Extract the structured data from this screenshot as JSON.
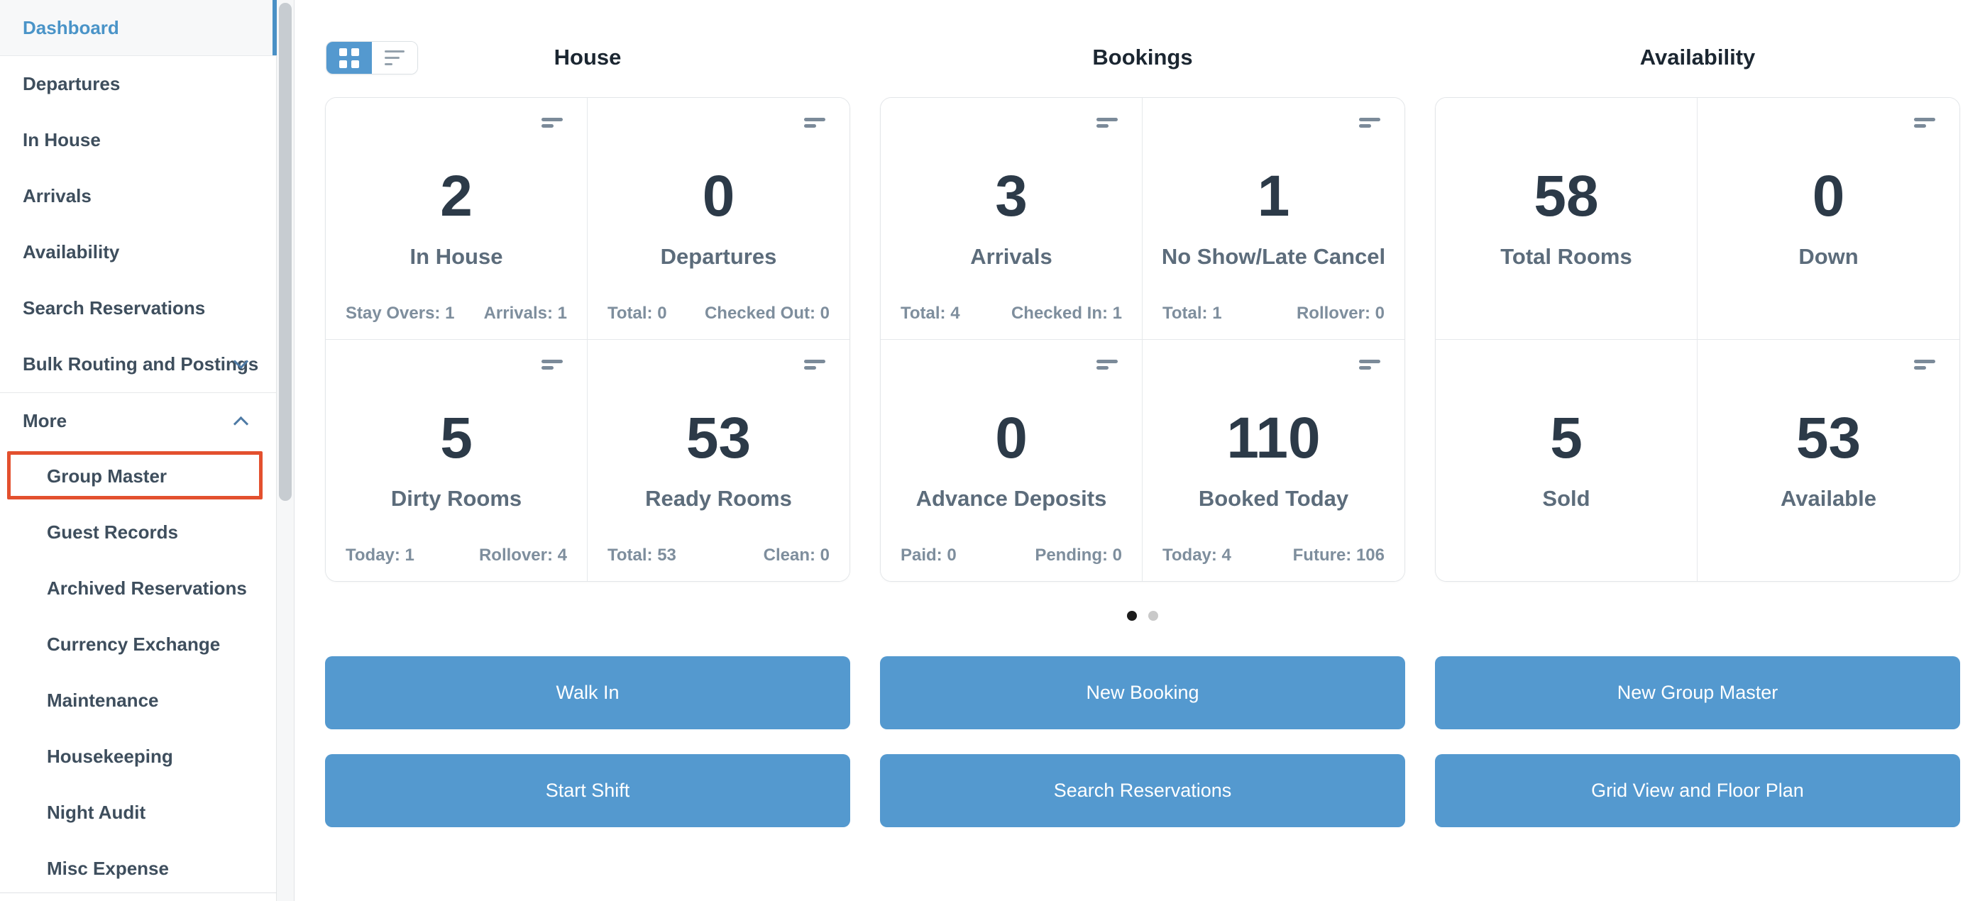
{
  "sidebar": {
    "items": [
      {
        "label": "Dashboard"
      },
      {
        "label": "Departures"
      },
      {
        "label": "In House"
      },
      {
        "label": "Arrivals"
      },
      {
        "label": "Availability"
      },
      {
        "label": "Search Reservations"
      },
      {
        "label": "Bulk Routing and Postings"
      },
      {
        "label": "More"
      },
      {
        "label": "Group Master"
      },
      {
        "label": "Guest Records"
      },
      {
        "label": "Archived Reservations"
      },
      {
        "label": "Currency Exchange"
      },
      {
        "label": "Maintenance"
      },
      {
        "label": "Housekeeping"
      },
      {
        "label": "Night Audit"
      },
      {
        "label": "Misc Expense"
      }
    ]
  },
  "view_toggle": {
    "icons": [
      "grid-view-icon",
      "list-view-icon"
    ],
    "active": "grid-view"
  },
  "sections": [
    {
      "title": "House",
      "tiles": [
        {
          "value": "2",
          "label": "In House",
          "stat_left": "Stay Overs: 1",
          "stat_right": "Arrivals: 1"
        },
        {
          "value": "0",
          "label": "Departures",
          "stat_left": "Total: 0",
          "stat_right": "Checked Out: 0"
        },
        {
          "value": "5",
          "label": "Dirty Rooms",
          "stat_left": "Today: 1",
          "stat_right": "Rollover: 4"
        },
        {
          "value": "53",
          "label": "Ready Rooms",
          "stat_left": "Total: 53",
          "stat_right": "Clean: 0"
        }
      ]
    },
    {
      "title": "Bookings",
      "tiles": [
        {
          "value": "3",
          "label": "Arrivals",
          "stat_left": "Total: 4",
          "stat_right": "Checked In: 1"
        },
        {
          "value": "1",
          "label": "No Show/Late Cancel",
          "stat_left": "Total: 1",
          "stat_right": "Rollover: 0"
        },
        {
          "value": "0",
          "label": "Advance Deposits",
          "stat_left": "Paid: 0",
          "stat_right": "Pending: 0"
        },
        {
          "value": "110",
          "label": "Booked Today",
          "stat_left": "Today: 4",
          "stat_right": "Future: 106"
        }
      ]
    },
    {
      "title": "Availability",
      "tiles": [
        {
          "value": "58",
          "label": "Total Rooms"
        },
        {
          "value": "0",
          "label": "Down"
        },
        {
          "value": "5",
          "label": "Sold"
        },
        {
          "value": "53",
          "label": "Available"
        }
      ]
    }
  ],
  "pagination": {
    "count": 2,
    "active_index": 0
  },
  "actions": [
    "Walk In",
    "New Booking",
    "New Group Master",
    "Start Shift",
    "Search Reservations",
    "Grid View and Floor Plan"
  ],
  "colors": {
    "accent_blue": "#5499cf",
    "active_link_blue": "#4a94c8",
    "highlight_outline_red": "#e3502e",
    "value_text": "#2c3a48",
    "label_text": "#5c6c7b",
    "stat_text": "#7e8e9d"
  }
}
